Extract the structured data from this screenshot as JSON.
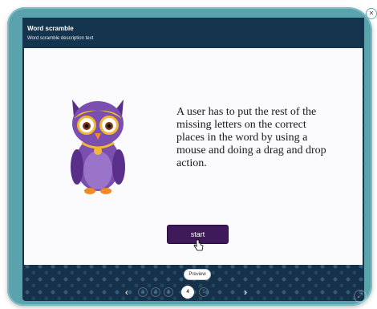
{
  "header": {
    "title": "Word scramble",
    "subtitle": "Word scramble description text"
  },
  "main": {
    "description": "A user has to put the rest of the missing letters on the correct places in the word by using a mouse and doing a drag and drop action.",
    "start_label": "start",
    "mascot_icon": "owl-icon"
  },
  "footer": {
    "preview_label": "Preview",
    "pages": [
      "1",
      "2",
      "3",
      "4",
      "5"
    ],
    "current_page": "4",
    "prev_icon": "chevron-left-icon",
    "next_icon": "chevron-right-icon",
    "fullscreen_icon": "fullscreen-icon"
  },
  "colors": {
    "frame": "#5aa3ad",
    "board": "#16314a",
    "start_button": "#3f1a5a",
    "owl_body": "#7a4fb0",
    "owl_accent": "#f4b731"
  }
}
